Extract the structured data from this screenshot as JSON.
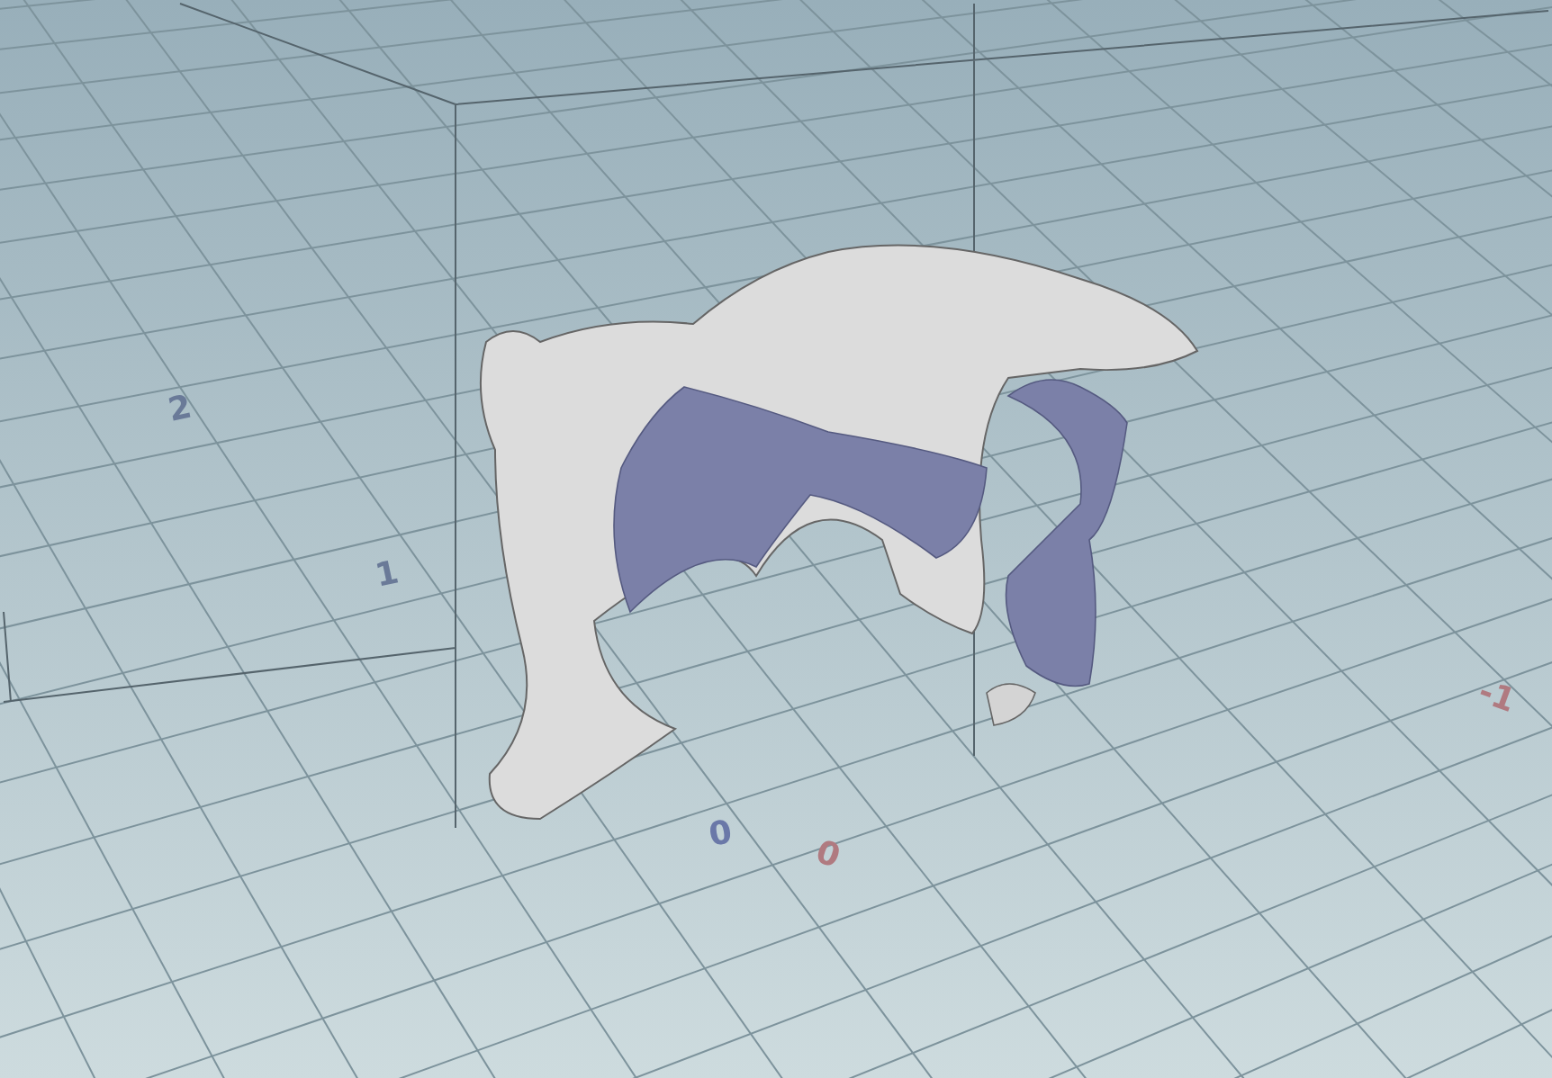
{
  "viewport": {
    "axis_labels": [
      {
        "text": "2",
        "color": "#6a7a98"
      },
      {
        "text": "1",
        "color": "#6a7a98"
      },
      {
        "text": "0",
        "color": "#6a78a8"
      },
      {
        "text": "0",
        "color": "#b07a80"
      },
      {
        "text": "-1",
        "color": "#b07a80"
      }
    ]
  }
}
